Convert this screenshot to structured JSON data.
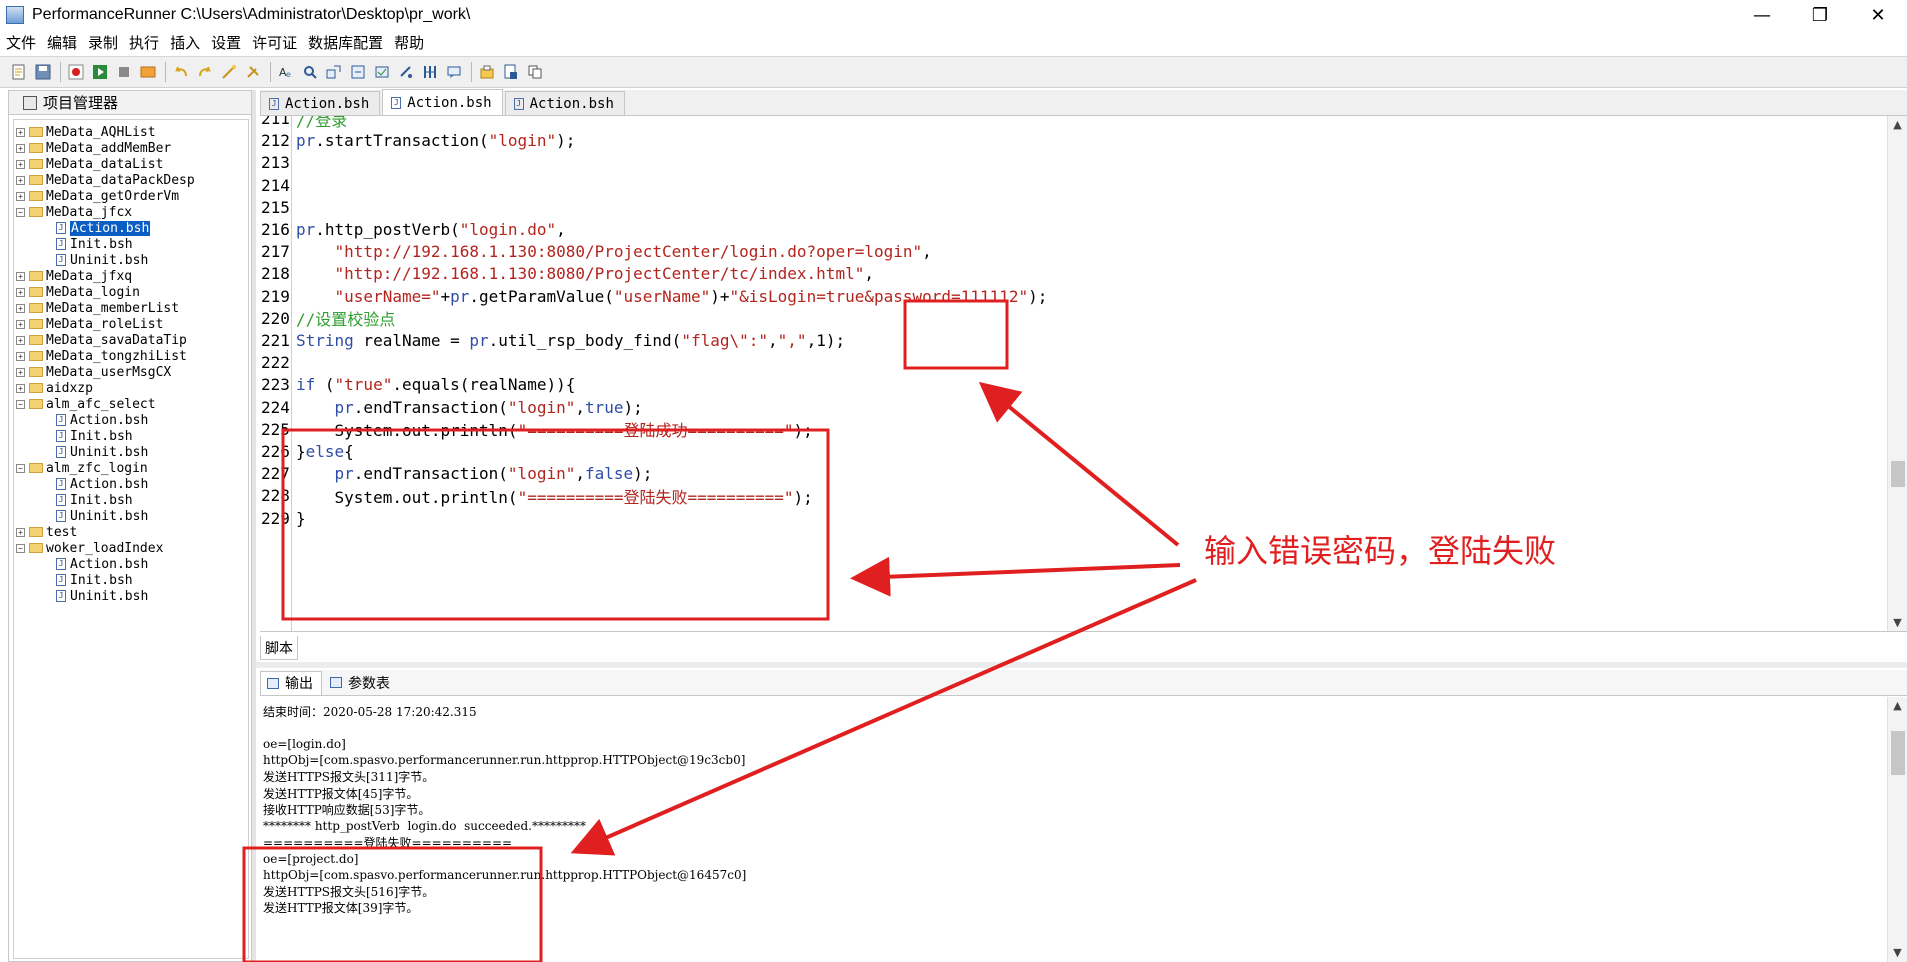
{
  "window": {
    "title": "PerformanceRunner  C:\\Users\\Administrator\\Desktop\\pr_work\\",
    "minimize": "—",
    "maximize": "❐",
    "close": "✕"
  },
  "menu": [
    "文件",
    "编辑",
    "录制",
    "执行",
    "插入",
    "设置",
    "许可证",
    "数据库配置",
    "帮助"
  ],
  "left_panel": {
    "title": "项目管理器",
    "tree": [
      {
        "type": "folder",
        "label": "MeData_AQHList",
        "expanded": false
      },
      {
        "type": "folder",
        "label": "MeData_addMemBer",
        "expanded": false
      },
      {
        "type": "folder",
        "label": "MeData_dataList",
        "expanded": false
      },
      {
        "type": "folder",
        "label": "MeData_dataPackDesp",
        "expanded": false
      },
      {
        "type": "folder",
        "label": "MeData_getOrderVm",
        "expanded": false
      },
      {
        "type": "folder",
        "label": "MeData_jfcx",
        "expanded": true
      },
      {
        "type": "file",
        "label": "Action.bsh",
        "selected": true
      },
      {
        "type": "file",
        "label": "Init.bsh"
      },
      {
        "type": "file",
        "label": "Uninit.bsh"
      },
      {
        "type": "folder",
        "label": "MeData_jfxq",
        "expanded": false
      },
      {
        "type": "folder",
        "label": "MeData_login",
        "expanded": false
      },
      {
        "type": "folder",
        "label": "MeData_memberList",
        "expanded": false
      },
      {
        "type": "folder",
        "label": "MeData_roleList",
        "expanded": false
      },
      {
        "type": "folder",
        "label": "MeData_savaDataTip",
        "expanded": false
      },
      {
        "type": "folder",
        "label": "MeData_tongzhiList",
        "expanded": false
      },
      {
        "type": "folder",
        "label": "MeData_userMsgCX",
        "expanded": false
      },
      {
        "type": "folder",
        "label": "aidxzp",
        "expanded": false
      },
      {
        "type": "folder",
        "label": "alm_afc_select",
        "expanded": true
      },
      {
        "type": "file",
        "label": "Action.bsh"
      },
      {
        "type": "file",
        "label": "Init.bsh"
      },
      {
        "type": "file",
        "label": "Uninit.bsh"
      },
      {
        "type": "folder",
        "label": "alm_zfc_login",
        "expanded": true
      },
      {
        "type": "file",
        "label": "Action.bsh"
      },
      {
        "type": "file",
        "label": "Init.bsh"
      },
      {
        "type": "file",
        "label": "Uninit.bsh"
      },
      {
        "type": "folder",
        "label": "test",
        "expanded": false
      },
      {
        "type": "folder",
        "label": "woker_loadIndex",
        "expanded": true
      },
      {
        "type": "file",
        "label": "Action.bsh"
      },
      {
        "type": "file",
        "label": "Init.bsh"
      },
      {
        "type": "file",
        "label": "Uninit.bsh"
      }
    ]
  },
  "editor": {
    "tabs": [
      {
        "label": "Action.bsh",
        "active": false
      },
      {
        "label": "Action.bsh",
        "active": true
      },
      {
        "label": "Action.bsh",
        "active": false
      }
    ],
    "bottom_tab": "脚本",
    "lines": [
      {
        "n": "211",
        "segs": [
          [
            "cm",
            "//登录"
          ]
        ]
      },
      {
        "n": "212",
        "segs": [
          [
            "kw",
            "pr"
          ],
          [
            "",
            ".startTransaction("
          ],
          [
            "str",
            "\"login\""
          ],
          [
            "",
            ");"
          ]
        ]
      },
      {
        "n": "213",
        "segs": []
      },
      {
        "n": "214",
        "segs": []
      },
      {
        "n": "215",
        "segs": []
      },
      {
        "n": "216",
        "segs": [
          [
            "kw",
            "pr"
          ],
          [
            "",
            ".http_postVerb("
          ],
          [
            "str",
            "\"login.do\""
          ],
          [
            "",
            ","
          ]
        ]
      },
      {
        "n": "217",
        "segs": [
          [
            "",
            "    "
          ],
          [
            "str",
            "\"http://192.168.1.130:8080/ProjectCenter/login.do?oper=login\""
          ],
          [
            "",
            ","
          ]
        ]
      },
      {
        "n": "218",
        "segs": [
          [
            "",
            "    "
          ],
          [
            "str",
            "\"http://192.168.1.130:8080/ProjectCenter/tc/index.html\""
          ],
          [
            "",
            ","
          ]
        ]
      },
      {
        "n": "219",
        "segs": [
          [
            "",
            "    "
          ],
          [
            "str",
            "\"userName=\""
          ],
          [
            "",
            "+"
          ],
          [
            "kw",
            "pr"
          ],
          [
            "",
            ".getParamValue("
          ],
          [
            "str",
            "\"userName\""
          ],
          [
            "",
            ")+"
          ],
          [
            "str",
            "\"&isLogin=true&password=111112\""
          ],
          [
            "",
            ");"
          ]
        ]
      },
      {
        "n": "220",
        "segs": [
          [
            "cm",
            "//设置校验点"
          ]
        ]
      },
      {
        "n": "221",
        "segs": [
          [
            "kw",
            "String"
          ],
          [
            "",
            " realName = "
          ],
          [
            "kw",
            "pr"
          ],
          [
            "",
            ".util_rsp_body_find("
          ],
          [
            "str",
            "\"flag\\\":\""
          ],
          [
            "",
            ","
          ],
          [
            "str",
            "\",\""
          ],
          [
            "",
            ",1);"
          ]
        ]
      },
      {
        "n": "222",
        "segs": []
      },
      {
        "n": "223",
        "segs": [
          [
            "kw",
            "if"
          ],
          [
            "",
            " ("
          ],
          [
            "str",
            "\"true\""
          ],
          [
            "",
            ".equals(realName)){"
          ]
        ]
      },
      {
        "n": "224",
        "segs": [
          [
            "",
            "    "
          ],
          [
            "kw",
            "pr"
          ],
          [
            "",
            ".endTransaction("
          ],
          [
            "str",
            "\"login\""
          ],
          [
            "",
            ","
          ],
          [
            "kw",
            "true"
          ],
          [
            "",
            ");"
          ]
        ]
      },
      {
        "n": "225",
        "segs": [
          [
            "",
            "    System.out.println("
          ],
          [
            "str",
            "\"==========登陆成功==========\""
          ],
          [
            "",
            ");"
          ]
        ]
      },
      {
        "n": "226",
        "segs": [
          [
            "",
            "}"
          ],
          [
            "kw",
            "else"
          ],
          [
            "",
            "{"
          ]
        ]
      },
      {
        "n": "227",
        "segs": [
          [
            "",
            "    "
          ],
          [
            "kw",
            "pr"
          ],
          [
            "",
            ".endTransaction("
          ],
          [
            "str",
            "\"login\""
          ],
          [
            "",
            ","
          ],
          [
            "kw",
            "false"
          ],
          [
            "",
            ");"
          ]
        ]
      },
      {
        "n": "228",
        "segs": [
          [
            "",
            "    System.out.println("
          ],
          [
            "str",
            "\"==========登陆失败==========\""
          ],
          [
            "",
            ");"
          ]
        ]
      },
      {
        "n": "229",
        "segs": [
          [
            "",
            "}"
          ]
        ]
      }
    ]
  },
  "output": {
    "tabs": [
      {
        "label": "输出",
        "active": true
      },
      {
        "label": "参数表",
        "active": false
      }
    ],
    "lines": [
      "结束时间：2020-05-28 17:20:42.315",
      "",
      "oe=[login.do]",
      "httpObj=[com.spasvo.performancerunner.run.httpprop.HTTPObject@19c3cb0]",
      "发送HTTPS报文头[311]字节。",
      "发送HTTP报文体[45]字节。",
      "接收HTTP响应数据[53]字节。",
      "******** http_postVerb  login.do  succeeded.*********",
      "==========登陆失败==========",
      "oe=[project.do]",
      "httpObj=[com.spasvo.performancerunner.run.httpprop.HTTPObject@16457c0]",
      "发送HTTPS报文头[516]字节。",
      "发送HTTP报文体[39]字节。"
    ]
  },
  "annotation": {
    "text": "输入错误密码，登陆失败",
    "color": "#e02020"
  },
  "colors": {
    "keyword": "#2e4da6",
    "string": "#b3241e",
    "comment": "#2f9e2f",
    "selection": "#0a5dc2"
  }
}
